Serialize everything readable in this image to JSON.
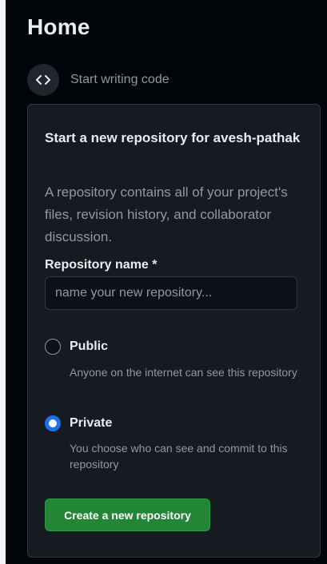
{
  "page": {
    "title": "Home"
  },
  "start_code": {
    "label": "Start writing code",
    "icon": "code-icon"
  },
  "new_repo": {
    "heading": "Start a new repository for avesh-pathak",
    "description": "A repository contains all of your project's files, revision history, and collaborator discussion.",
    "name_label": "Repository name *",
    "name_value": "",
    "name_placeholder": "name your new repository...",
    "visibility": {
      "selected": "private",
      "public": {
        "label": "Public",
        "help": "Anyone on the internet can see this repository"
      },
      "private": {
        "label": "Private",
        "help": "You choose who can see and commit to this repository"
      }
    },
    "create_label": "Create a new repository"
  },
  "colors": {
    "background": "#010409",
    "card": "#161b22",
    "accent_blue": "#1f6feb",
    "button_green": "#238636",
    "muted_text": "#9198a1"
  }
}
